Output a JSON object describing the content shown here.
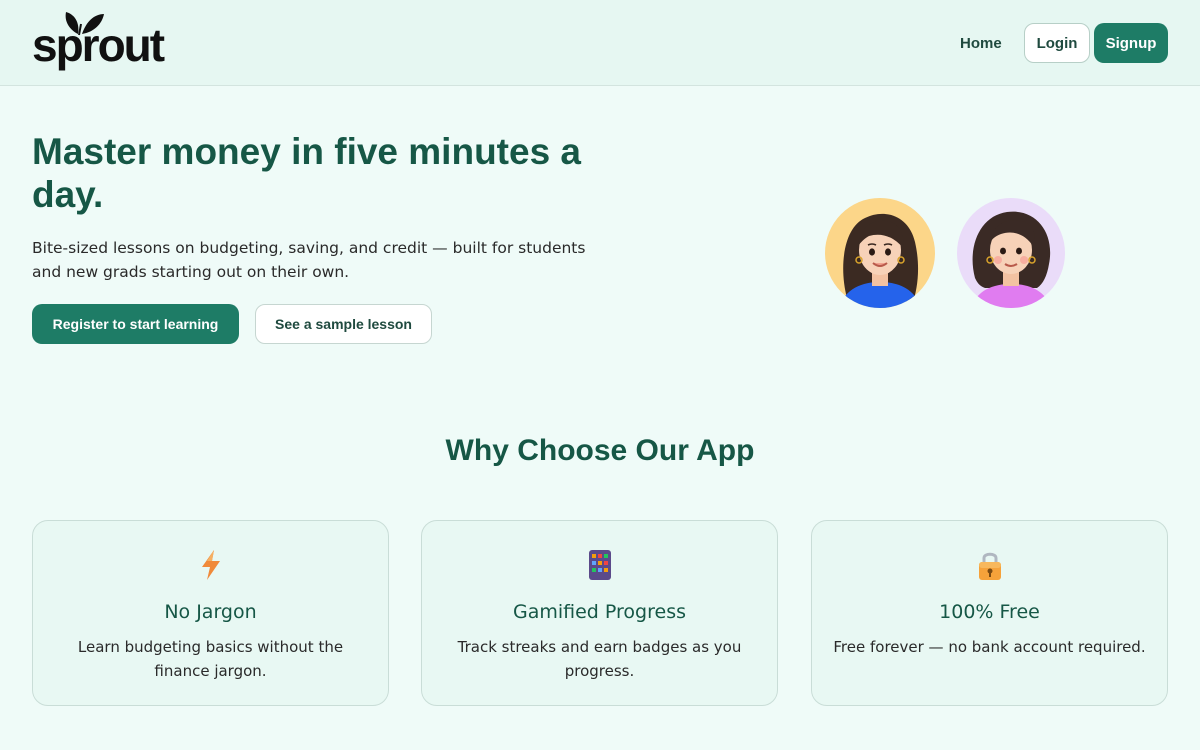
{
  "header": {
    "logo_text": "sprout",
    "nav_home": "Home",
    "login_label": "Login",
    "signup_label": "Signup"
  },
  "hero": {
    "title": "Master money in five minutes a day.",
    "subtitle": "Bite-sized lessons on budgeting, saving, and credit — built for students and new grads starting out on their own.",
    "register_label": "Register to start learning",
    "sample_label": "See a sample lesson"
  },
  "features": {
    "title": "Why Choose Our App",
    "cards": [
      {
        "icon": "lightning-icon",
        "title": "No Jargon",
        "text": "Learn budgeting basics without the finance jargon."
      },
      {
        "icon": "abacus-icon",
        "title": "Gamified Progress",
        "text": "Track streaks and earn badges as you progress."
      },
      {
        "icon": "lock-icon",
        "title": "100% Free",
        "text": "Free forever — no bank account required."
      }
    ]
  },
  "colors": {
    "brand": "#1e7c66",
    "heading": "#165746",
    "background": "#effbf8"
  }
}
